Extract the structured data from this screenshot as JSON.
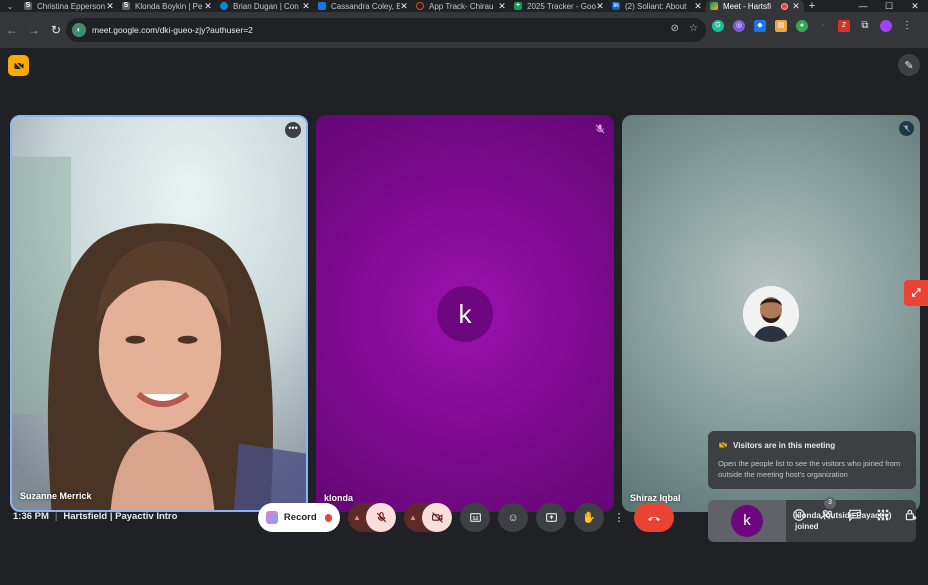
{
  "browser": {
    "tabs": [
      {
        "title": "Christina Epperson",
        "favicon": "S",
        "fav_color": "#5f6368"
      },
      {
        "title": "Klonda Boykin | Pe",
        "favicon": "S",
        "fav_color": "#5f6368"
      },
      {
        "title": "Brian Dugan | Con",
        "favicon": "",
        "fav_color": "#0b84d8"
      },
      {
        "title": "Cassandra Coley, E",
        "favicon": "",
        "fav_color": "#1a73e8"
      },
      {
        "title": "App Track- Chirau",
        "favicon": "",
        "fav_color": "#ea4335"
      },
      {
        "title": "2025 Tracker - Goo",
        "favicon": "+",
        "fav_color": "#0f9d58"
      },
      {
        "title": "(2) Soliant: About",
        "favicon": "in",
        "fav_color": "#0a66c2"
      },
      {
        "title": "Meet - Hartsfi",
        "favicon": "",
        "fav_color": "#00897b",
        "active": true
      }
    ],
    "url": "meet.google.com/dki-gueo-zjy?authuser=2"
  },
  "tiles": [
    {
      "name": "Suzanne Merrick"
    },
    {
      "name": "klonda",
      "initial": "k"
    },
    {
      "name": "Shiraz Iqbal"
    }
  ],
  "notice": {
    "title": "Visitors are in this meeting",
    "body": "Open the people list to see the visitors who joined from outside the meeting host's organization"
  },
  "joined": {
    "initial": "k",
    "text_line1": "klonda (outside Payactiv)",
    "text_line2": "joined"
  },
  "meeting": {
    "time": "1:36 PM",
    "separator": "|",
    "title": "Hartsfield | Payactiv Intro"
  },
  "controls": {
    "record_label": "Record",
    "people_count": "3"
  },
  "colors": {
    "accent_red": "#ea4335",
    "tile_purple": "#7b0a8c",
    "speaking_border": "#8ab4f8"
  }
}
